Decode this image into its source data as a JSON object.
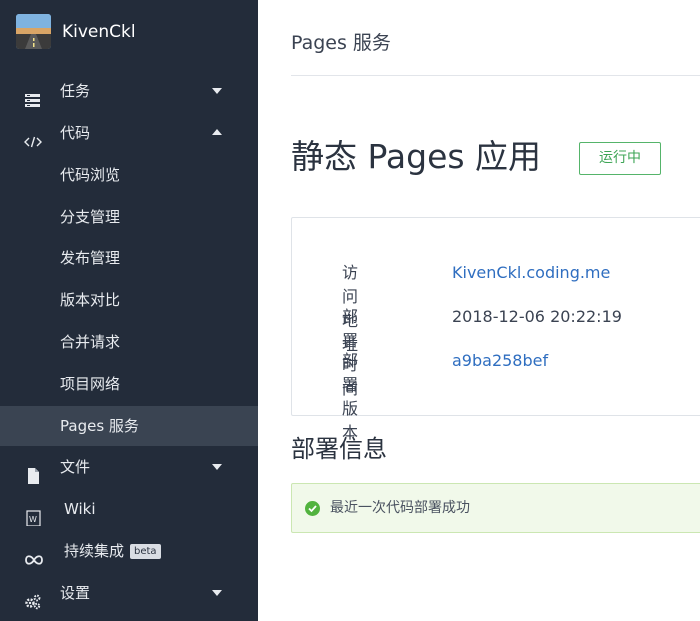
{
  "brand": {
    "name": "KivenCkl"
  },
  "sidebar": {
    "tasks": {
      "label": "任务",
      "icon": "tasks-icon"
    },
    "code": {
      "label": "代码",
      "icon": "code-icon"
    },
    "code_sub": [
      {
        "label": "代码浏览"
      },
      {
        "label": "分支管理"
      },
      {
        "label": "发布管理"
      },
      {
        "label": "版本对比"
      },
      {
        "label": "合并请求"
      },
      {
        "label": "项目网络"
      },
      {
        "label": "Pages 服务"
      }
    ],
    "files": {
      "label": "文件",
      "icon": "file-icon"
    },
    "wiki": {
      "label": "Wiki",
      "icon": "wiki-icon"
    },
    "ci": {
      "label": "持续集成",
      "badge": "beta",
      "icon": "infinity-icon"
    },
    "settings": {
      "label": "设置",
      "icon": "gears-icon"
    }
  },
  "main": {
    "header": "Pages 服务",
    "title": "静态 Pages 应用",
    "status": "运行中",
    "info": {
      "url_label": "访问地址",
      "url_value": "KivenCkl.coding.me",
      "time_label": "部署时间",
      "time_value": "2018-12-06 20:22:19",
      "version_label": "部署版本",
      "version_value": "a9ba258bef"
    },
    "section_title": "部署信息",
    "alert_message": "最近一次代码部署成功"
  },
  "colors": {
    "sidebar_bg": "#232c3a",
    "active_bg": "#3a4452",
    "link": "#2f6ec0",
    "success": "#52b33f"
  }
}
